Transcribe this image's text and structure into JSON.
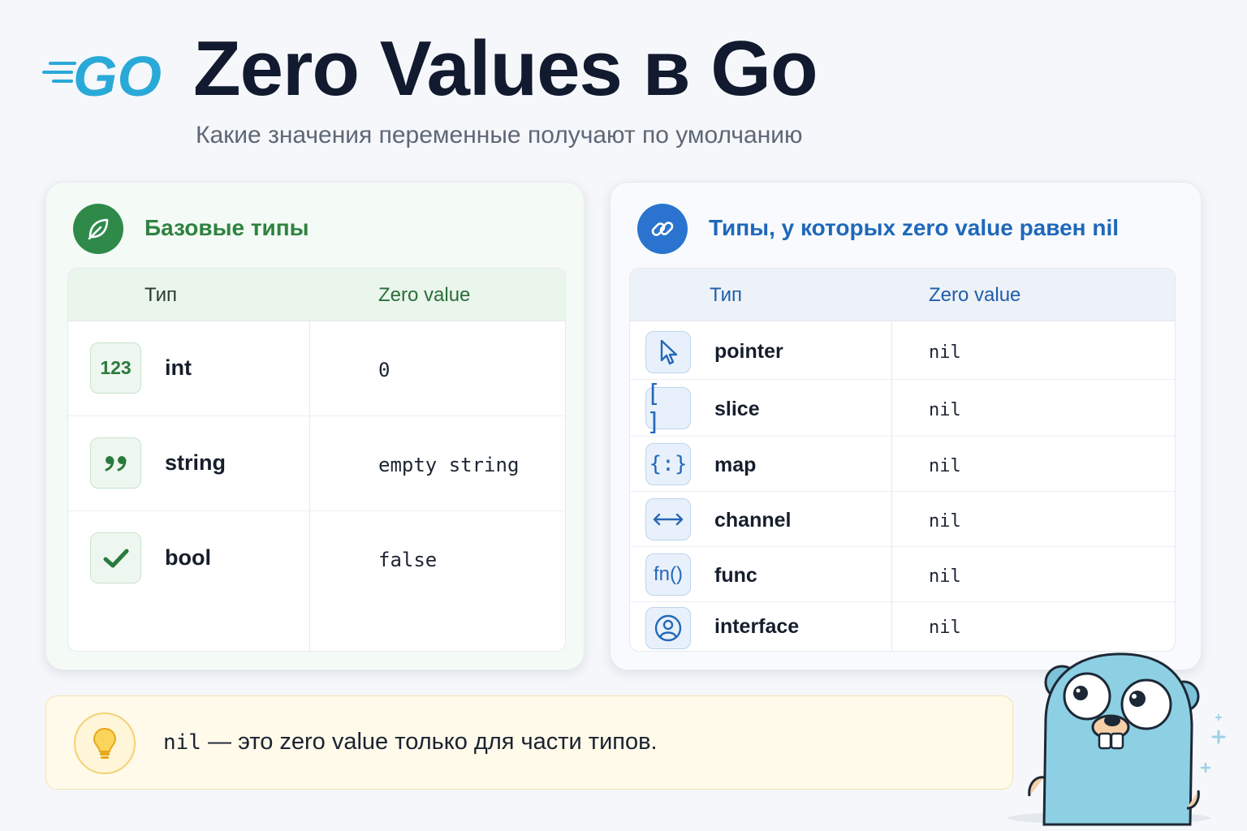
{
  "header": {
    "logo_text": "GO",
    "title": "Zero Values в Go",
    "subtitle": "Какие значения переменные получают по умолчанию"
  },
  "left_card": {
    "title": "Базовые типы",
    "icon": "leaf-icon",
    "columns": [
      "Тип",
      "Zero value"
    ],
    "rows": [
      {
        "icon": "number-icon",
        "icon_text": "123",
        "type": "int",
        "value": "0"
      },
      {
        "icon": "quote-icon",
        "icon_text": "❞",
        "type": "string",
        "value": "empty string"
      },
      {
        "icon": "check-icon",
        "icon_text": "✓",
        "type": "bool",
        "value": "false"
      }
    ]
  },
  "right_card": {
    "title": "Типы, у которых zero value равен nil",
    "icon": "link-icon",
    "columns": [
      "Тип",
      "Zero value"
    ],
    "rows": [
      {
        "icon": "cursor-icon",
        "icon_text": "",
        "type": "pointer",
        "value": "nil"
      },
      {
        "icon": "brackets-icon",
        "icon_text": "[ ]",
        "type": "slice",
        "value": "nil"
      },
      {
        "icon": "braces-icon",
        "icon_text": "{:}",
        "type": "map",
        "value": "nil"
      },
      {
        "icon": "arrows-icon",
        "icon_text": "<->",
        "type": "channel",
        "value": "nil"
      },
      {
        "icon": "function-icon",
        "icon_text": "fn()",
        "type": "func",
        "value": "nil"
      },
      {
        "icon": "person-icon",
        "icon_text": "",
        "type": "interface",
        "value": "nil"
      }
    ]
  },
  "note": {
    "icon": "lightbulb-icon",
    "code": "nil",
    "text": " — это zero value только для части типов."
  },
  "colors": {
    "green": "#2f8a4a",
    "blue": "#2a74cf",
    "go_cyan": "#29a9d8",
    "title": "#111a2e"
  }
}
